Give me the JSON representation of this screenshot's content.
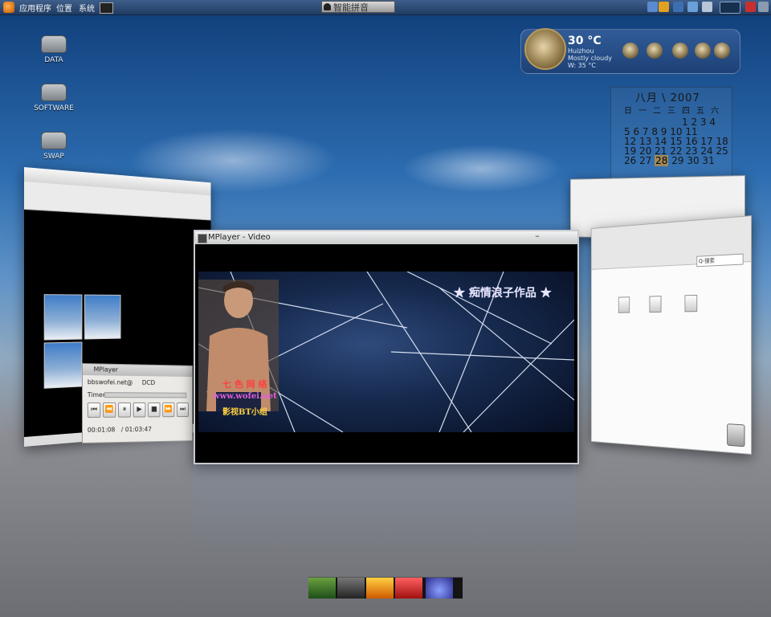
{
  "top_panel": {
    "menus": [
      "应用程序",
      "位置",
      "系统"
    ],
    "input_method": "智能拼音"
  },
  "desktop_icons": [
    {
      "label": "DATA"
    },
    {
      "label": "SOFTWARE"
    },
    {
      "label": "SWAP"
    }
  ],
  "weather": {
    "temperature": "30 °C",
    "city": "Huizhou",
    "condition": "Mostly cloudy",
    "wind": "W: 35 °C"
  },
  "calendar": {
    "title": "八月 \\ 2007",
    "weekday_header": "日一二三四五六",
    "rows": [
      "1  2  3  4",
      "5  6  7  8  9 10 11",
      "12 13 14 15 16 17 18",
      "19 20 21 22 23 24 25"
    ],
    "last_row_before": "26 27 ",
    "today": "28",
    "last_row_after": " 29 30 31"
  },
  "main_window": {
    "title": "MPlayer - Video",
    "video_overlay_right": "★ 痴情浪子作品 ★",
    "video_overlay_left_1": "七 色 网 络",
    "video_overlay_left_2": "www.wofei.net",
    "video_overlay_left_3": "影视BT小组"
  },
  "mplayer_control": {
    "title": "MPlayer",
    "file_line": "bbswofei.net@",
    "codec": "DCD",
    "timer_label": "Timer",
    "position": "00:01:08",
    "duration": "/ 01:03:47"
  },
  "file_manager": {
    "search_placeholder": "Q-搜索"
  }
}
